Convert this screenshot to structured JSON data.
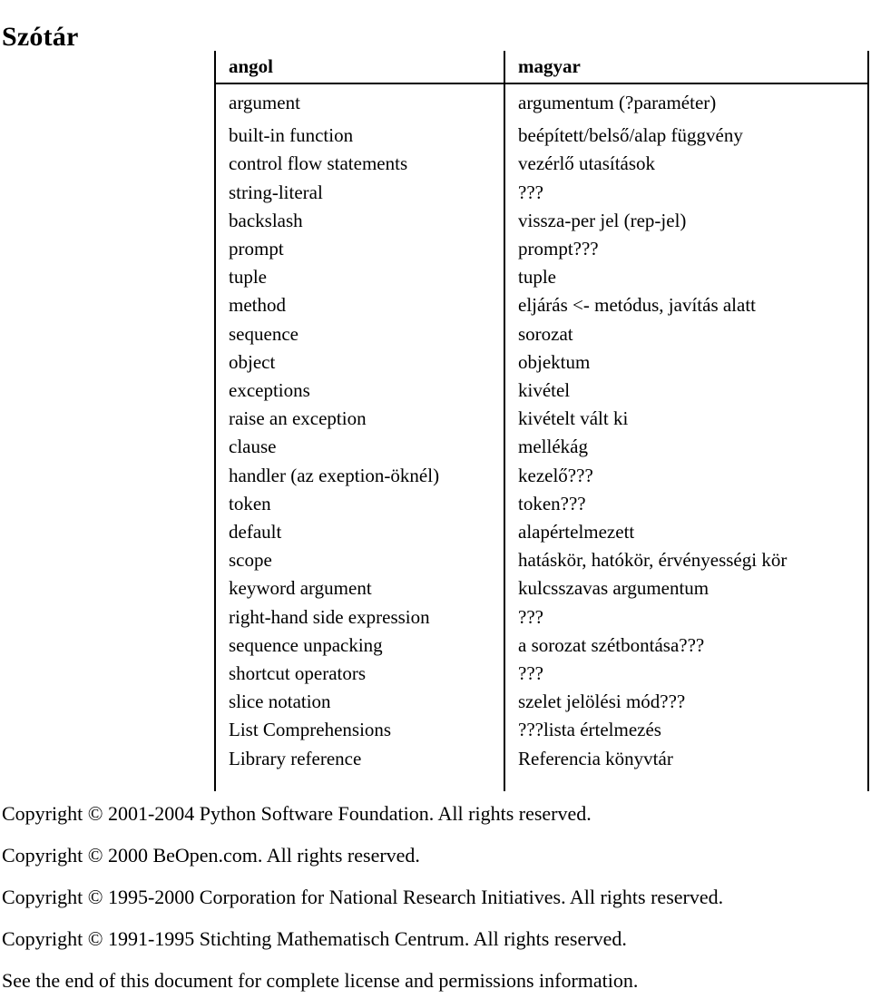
{
  "document": {
    "title": "Szótár"
  },
  "glossary": {
    "headers": {
      "english": "angol",
      "hungarian": "magyar"
    },
    "rows": [
      {
        "english": "argument",
        "hungarian": "argumentum (?paraméter)"
      },
      {
        "english": "built-in function",
        "hungarian": "beépített/belső/alap függvény"
      },
      {
        "english": "control flow statements",
        "hungarian": "vezérlő utasítások"
      },
      {
        "english": "string-literal",
        "hungarian": "???"
      },
      {
        "english": "backslash",
        "hungarian": "vissza-per jel (rep-jel)"
      },
      {
        "english": "prompt",
        "hungarian": "prompt???"
      },
      {
        "english": "tuple",
        "hungarian": "tuple"
      },
      {
        "english": "method",
        "hungarian": "eljárás <- metódus, javítás alatt"
      },
      {
        "english": "sequence",
        "hungarian": "sorozat"
      },
      {
        "english": "object",
        "hungarian": "objektum"
      },
      {
        "english": "exceptions",
        "hungarian": "kivétel"
      },
      {
        "english": "raise an exception",
        "hungarian": "kivételt vált ki"
      },
      {
        "english": "clause",
        "hungarian": "mellékág"
      },
      {
        "english": "handler (az exeption-öknél)",
        "hungarian": "kezelő???"
      },
      {
        "english": "token",
        "hungarian": "token???"
      },
      {
        "english": "default",
        "hungarian": "alapértelmezett"
      },
      {
        "english": "scope",
        "hungarian": "hatáskör, hatókör, érvényességi kör"
      },
      {
        "english": "keyword argument",
        "hungarian": "kulcsszavas argumentum"
      },
      {
        "english": "right-hand side expression",
        "hungarian": "???"
      },
      {
        "english": "sequence unpacking",
        "hungarian": "a sorozat szétbontása???"
      },
      {
        "english": "shortcut operators",
        "hungarian": "???"
      },
      {
        "english": "slice notation",
        "hungarian": "szelet jelölési mód???"
      },
      {
        "english": "List Comprehensions",
        "hungarian": "???lista értelmezés"
      },
      {
        "english": "Library reference",
        "hungarian": "Referencia könyvtár"
      }
    ]
  },
  "footer": {
    "lines": [
      "Copyright © 2001-2004 Python Software Foundation. All rights reserved.",
      "Copyright © 2000 BeOpen.com. All rights reserved.",
      "Copyright © 1995-2000 Corporation for National Research Initiatives. All rights reserved.",
      "Copyright © 1991-1995 Stichting Mathematisch Centrum. All rights reserved.",
      "See the end of this document for complete license and permissions information."
    ]
  }
}
